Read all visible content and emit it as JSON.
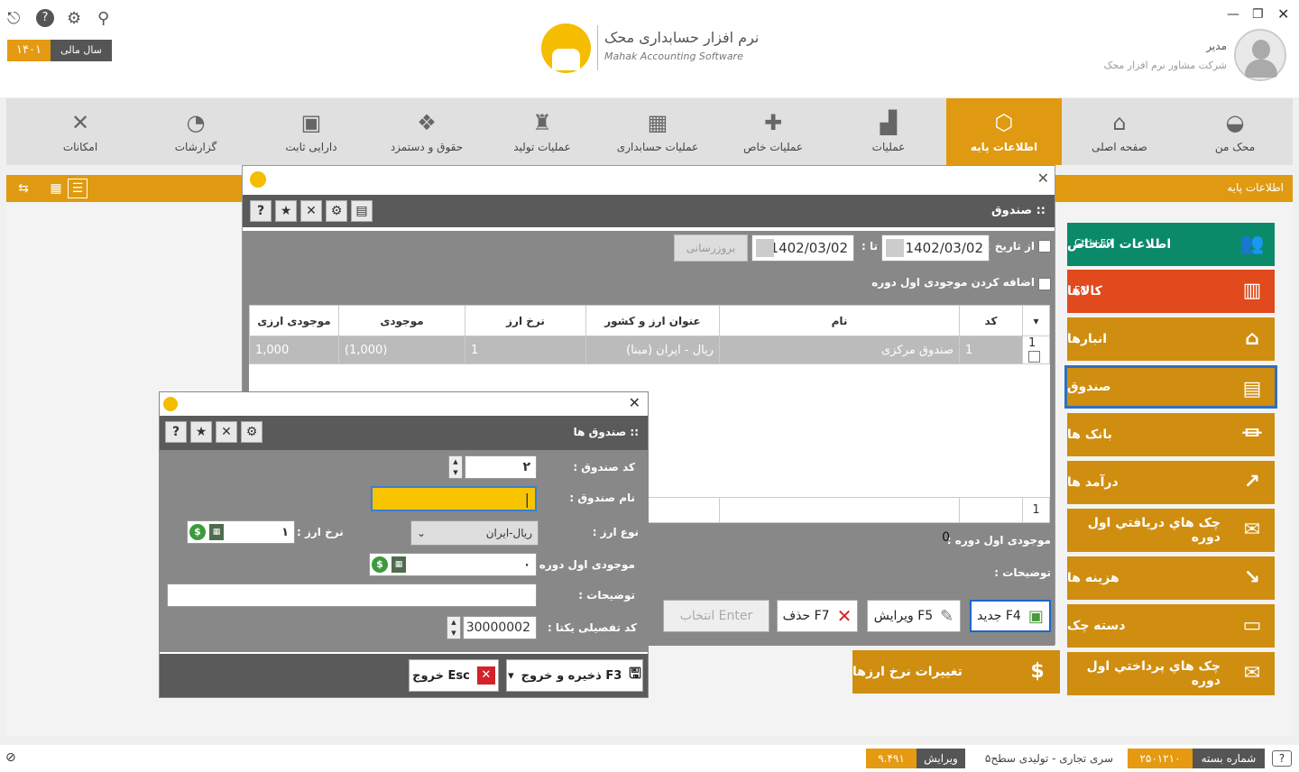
{
  "fiscal_year": {
    "label": "سال مالی",
    "value": "۱۴۰۱"
  },
  "logo": {
    "title": "نرم افزار حسابداری محک",
    "subtitle": "Mahak Accounting Software"
  },
  "user": {
    "name": "مدیر",
    "company": "شرکت مشاور نرم افزار محک"
  },
  "nav": [
    {
      "label": "محک من",
      "icon": "mahak-icon"
    },
    {
      "label": "صفحه اصلی",
      "icon": "home-icon"
    },
    {
      "label": "اطلاعات پایه",
      "icon": "cube-icon",
      "active": true
    },
    {
      "label": "عملیات",
      "icon": "register-icon"
    },
    {
      "label": "عملیات خاص",
      "icon": "puzzle-icon"
    },
    {
      "label": "عملیات حسابداری",
      "icon": "calculator-icon"
    },
    {
      "label": "عملیات تولید",
      "icon": "factory-icon"
    },
    {
      "label": "حقوق و دستمزد",
      "icon": "salary-icon"
    },
    {
      "label": "دارایی ثابت",
      "icon": "asset-icon"
    },
    {
      "label": "گزارشات",
      "icon": "report-icon"
    },
    {
      "label": "امکانات",
      "icon": "tools-icon"
    }
  ],
  "breadcrumb": "اطلاعات پایه",
  "right_menu": [
    {
      "label": "اطلاعات اشخاص",
      "key": "Ctrl+F9",
      "color": "#0b8a6a",
      "icon": "people-icon"
    },
    {
      "label": "کالاها",
      "key": "F8",
      "color": "#e04a1c",
      "icon": "goods-icon"
    },
    {
      "label": "انبارها",
      "key": "",
      "color": "#cf8e10",
      "icon": "warehouse-icon"
    },
    {
      "label": "صندوق",
      "key": "",
      "color": "#cf8e10",
      "icon": "cashbox-icon"
    },
    {
      "label": "بانک ها",
      "key": "",
      "color": "#cf8e10",
      "icon": "bank-icon"
    },
    {
      "label": "درآمد ها",
      "key": "",
      "color": "#cf8e10",
      "icon": "income-icon"
    },
    {
      "label": "چک هاي دريافتي اول دوره",
      "key": "",
      "color": "#cf8e10",
      "icon": "cheque-in-icon"
    },
    {
      "label": "هزینه ها",
      "key": "",
      "color": "#cf8e10",
      "icon": "expense-icon"
    },
    {
      "label": "دسته چک",
      "key": "",
      "color": "#cf8e10",
      "icon": "chequebook-icon"
    },
    {
      "label": "چک هاي پرداختي اول دوره",
      "key": "",
      "color": "#cf8e10",
      "icon": "cheque-out-icon"
    }
  ],
  "middle_menu": {
    "label": "تغییرات نرخ ارزها",
    "icon": "currency-rate-icon"
  },
  "win1": {
    "title": ":: صندوق",
    "from_label": "از تاریخ :",
    "from_date": "1402/03/02",
    "to_label": "تا :",
    "to_date": "1402/03/02",
    "refresh": "بروزرسانی",
    "add_opening": "اضافه کردن موجودی اول دوره",
    "columns": [
      "کد",
      "نام",
      "عنوان ارز و کشور",
      "نرخ ارز",
      "موجودی",
      "موجودی ارزی"
    ],
    "rows": [
      {
        "no": "1",
        "code": "1",
        "name": "صندوق مرکزی",
        "currency": "ریال - ایران (مبنا)",
        "rate": "1",
        "balance": "(1,000)",
        "fx_balance": "1,000"
      }
    ],
    "footer_count": "1",
    "opening_label": "موجودی اول دوره :",
    "opening_value": "0",
    "notes_label": "توضیحات :",
    "buttons": {
      "new": "جدید F4",
      "edit": "ویرایش F5",
      "delete": "حذف F7",
      "select": "انتخاب Enter"
    }
  },
  "win2": {
    "title": ":: صندوق ها",
    "code_label": "کد صندوق :",
    "code_value": "۲",
    "name_label": "نام صندوق :",
    "currency_label": "نوع ارز :",
    "currency_value": "ریال-ایران",
    "rate_label": "نرخ ارز :",
    "rate_value": "۱",
    "opening_label": "موجودی اول دوره :",
    "opening_value": "۰",
    "notes_label": "توضیحات :",
    "unique_label": "کد تفصیلی یکتا :",
    "unique_value": "30000002",
    "save": "ذخیره و خروج F3",
    "exit": "خروج Esc"
  },
  "status": {
    "package_label": "شماره بسته",
    "package_value": "۲۵۰۱۲۱۰",
    "edition": "سری تجاری - تولیدی سطح۵",
    "version_label": "ویرایش",
    "version_value": "۹.۴۹۱"
  }
}
